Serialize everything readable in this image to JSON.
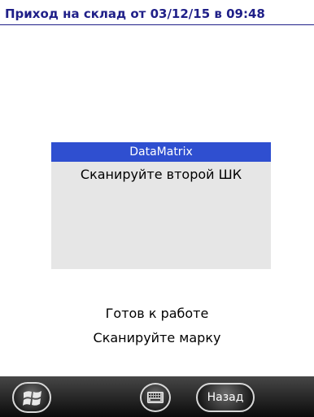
{
  "header": {
    "title": "Приход на склад от 03/12/15 в 09:48"
  },
  "scan_panel": {
    "header_label": "DataMatrix",
    "instruction": "Сканируйте второй ШК"
  },
  "status": {
    "line1": "Готов к работе",
    "line2": "Сканируйте марку"
  },
  "taskbar": {
    "start_icon": "windows-flag-icon",
    "keyboard_icon": "keyboard-icon",
    "back_label": "Назад"
  }
}
